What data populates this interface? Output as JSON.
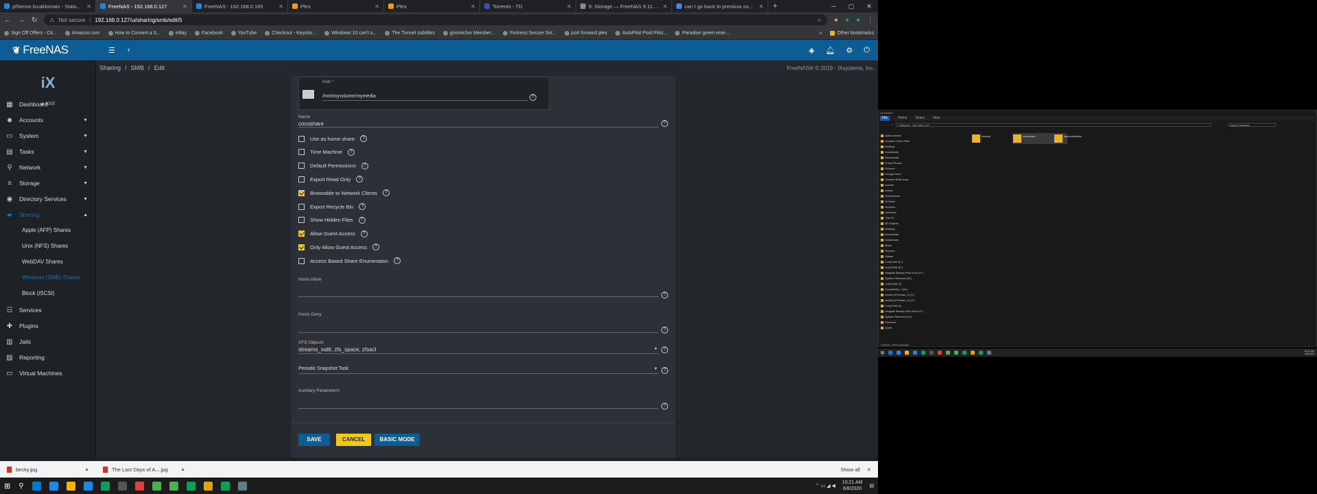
{
  "browser": {
    "tabs": [
      {
        "title": "pfSense.localdomain - Status: D...",
        "color": "#1e88e5"
      },
      {
        "title": "FreeNAS - 192.168.0.127",
        "color": "#1e88e5",
        "active": true
      },
      {
        "title": "FreeNAS - 192.168.0.165",
        "color": "#1e88e5"
      },
      {
        "title": "Plex",
        "color": "#e5a00d"
      },
      {
        "title": "Plex",
        "color": "#e5a00d"
      },
      {
        "title": "Torrents - TD",
        "color": "#3f51b5"
      },
      {
        "title": "9: Storage — FreeNAS 9.11.2-U3",
        "color": "#888888"
      },
      {
        "title": "can I go back to previous config...",
        "color": "#4285f4"
      }
    ],
    "not_secure": "Not secure",
    "url": "192.168.0.127/ui/sharing/smb/edit/5",
    "bookmarks": [
      "Sign Off Offers - Cit...",
      "Amazon.com",
      "How to Convert a S...",
      "eBay",
      "Facebook",
      "YouTube",
      "Checkout - Keystor...",
      "Windows 10 can't s...",
      "The Tunnel subtitles",
      "gnomicfun Member...",
      "Fortress Secure Sol...",
      "port forward plex",
      "AutoPilot Pool Pilot...",
      "Paradise green ener..."
    ],
    "other_bookmarks": "Other bookmarks"
  },
  "app": {
    "logo": "FreeNAS",
    "copyright": "FreeNAS® © 2019 - iXsystems, Inc.",
    "breadcrumb": [
      "Sharing",
      "/",
      "SMB",
      "/",
      "Edit"
    ],
    "user": "root",
    "ix_logo": "iX"
  },
  "sidebar": {
    "items": [
      {
        "label": "Dashboard",
        "icon": "dashboard-icon",
        "glyph": "▦",
        "expandable": false
      },
      {
        "label": "Accounts",
        "icon": "accounts-icon",
        "glyph": "☻",
        "expandable": true
      },
      {
        "label": "System",
        "icon": "system-icon",
        "glyph": "▭",
        "expandable": true
      },
      {
        "label": "Tasks",
        "icon": "tasks-icon",
        "glyph": "▤",
        "expandable": true
      },
      {
        "label": "Network",
        "icon": "network-icon",
        "glyph": "⚲",
        "expandable": true
      },
      {
        "label": "Storage",
        "icon": "storage-icon",
        "glyph": "≡",
        "expandable": true
      },
      {
        "label": "Directory Services",
        "icon": "directory-icon",
        "glyph": "◉",
        "expandable": true
      },
      {
        "label": "Sharing",
        "icon": "sharing-icon",
        "glyph": "▰",
        "expandable": true,
        "active": true
      }
    ],
    "sharing_sub": [
      {
        "label": "Apple (AFP) Shares"
      },
      {
        "label": "Unix (NFS) Shares"
      },
      {
        "label": "WebDAV Shares"
      },
      {
        "label": "Windows (SMB) Shares",
        "active": true
      },
      {
        "label": "Block (iSCSI)"
      }
    ],
    "items_after": [
      {
        "label": "Services",
        "icon": "services-icon",
        "glyph": "☷"
      },
      {
        "label": "Plugins",
        "icon": "plugins-icon",
        "glyph": "✚"
      },
      {
        "label": "Jails",
        "icon": "jails-icon",
        "glyph": "▥"
      },
      {
        "label": "Reporting",
        "icon": "reporting-icon",
        "glyph": "▨"
      },
      {
        "label": "Virtual Machines",
        "icon": "vm-icon",
        "glyph": "▭"
      }
    ]
  },
  "form": {
    "path_label": "Path *",
    "path_value": "/mnt/myvolume/mymedia",
    "name_label": "Name",
    "name_value": "cocoshare",
    "checkboxes": [
      {
        "label": "Use as home share",
        "checked": false
      },
      {
        "label": "Time Machine",
        "checked": false
      },
      {
        "label": "Default Permissions",
        "checked": false
      },
      {
        "label": "Export Read Only",
        "checked": false
      },
      {
        "label": "Browsable to Network Clients",
        "checked": true
      },
      {
        "label": "Export Recycle Bin",
        "checked": false
      },
      {
        "label": "Show Hidden Files",
        "checked": false
      },
      {
        "label": "Allow Guest Access",
        "checked": true
      },
      {
        "label": "Only Allow Guest Access",
        "checked": true
      },
      {
        "label": "Access Based Share Enumeration",
        "checked": false
      }
    ],
    "hosts_allow_label": "Hosts Allow",
    "hosts_deny_label": "Hosts Deny",
    "vfs_label": "VFS Objects",
    "vfs_value": "streams_xattr, zfs_space, zfsacl",
    "snapshot_label": "Periodic Snapshot Task",
    "aux_label": "Auxiliary Parameters",
    "save": "SAVE",
    "cancel": "CANCEL",
    "basic_mode": "BASIC MODE"
  },
  "downloads": {
    "items": [
      "becky.jpg",
      "The Last Days of A....jpg"
    ],
    "show_all": "Show all"
  },
  "taskbar": {
    "icons": [
      "#0078d7",
      "#1e88e5",
      "#f4b400",
      "#1e88e5",
      "#0f9d58",
      "#555555",
      "#db4437",
      "#4caf50",
      "#4caf50",
      "#0f9d58",
      "#e5a00d",
      "#0f9d58",
      "#607d8b"
    ],
    "time": "10:21 AM",
    "date": "6/8/2020"
  },
  "explorer": {
    "title": "cocoshare",
    "ribbon": [
      "File",
      "Home",
      "Share",
      "View"
    ],
    "address": "› Network › 192.168.0.127",
    "search": "Search Network",
    "nav": [
      "Quick access",
      "Creative Cloud Files",
      "Desktop",
      "Downloads",
      "Documents",
      "iCloud Photos",
      "Pictures",
      "Google Drive",
      "Chelsea Witts book",
      "movies",
      "scripts",
      "Screenshots",
      "To Move",
      "Dropbox",
      "OneDrive",
      "This PC",
      "3D Objects",
      "Desktop",
      "Documents",
      "Downloads",
      "Music",
      "Pictures",
      "Videos",
      "Local Disk (C:)",
      "Local Disk (E:)",
      "Seagate Backup Plus Drive (F:)",
      "System Reserved (H:)",
      "Local Disk (I:)",
      "CocoMedia_1 (M:)",
      "media (\\\\Freenas_1) (Y:)",
      "media (\\\\Freenas_2) (Z:)",
      "Local Disk (I:)",
      "Seagate Backup Plus Drive (F:)",
      "System Reserved (H:)",
      "Personal",
      "Zoom"
    ],
    "files": [
      "backup",
      "cocoshare",
      "mymediashare"
    ],
    "status": "3 items    1 item selected",
    "time": "10:21 AM",
    "date": "6/8/2020"
  }
}
